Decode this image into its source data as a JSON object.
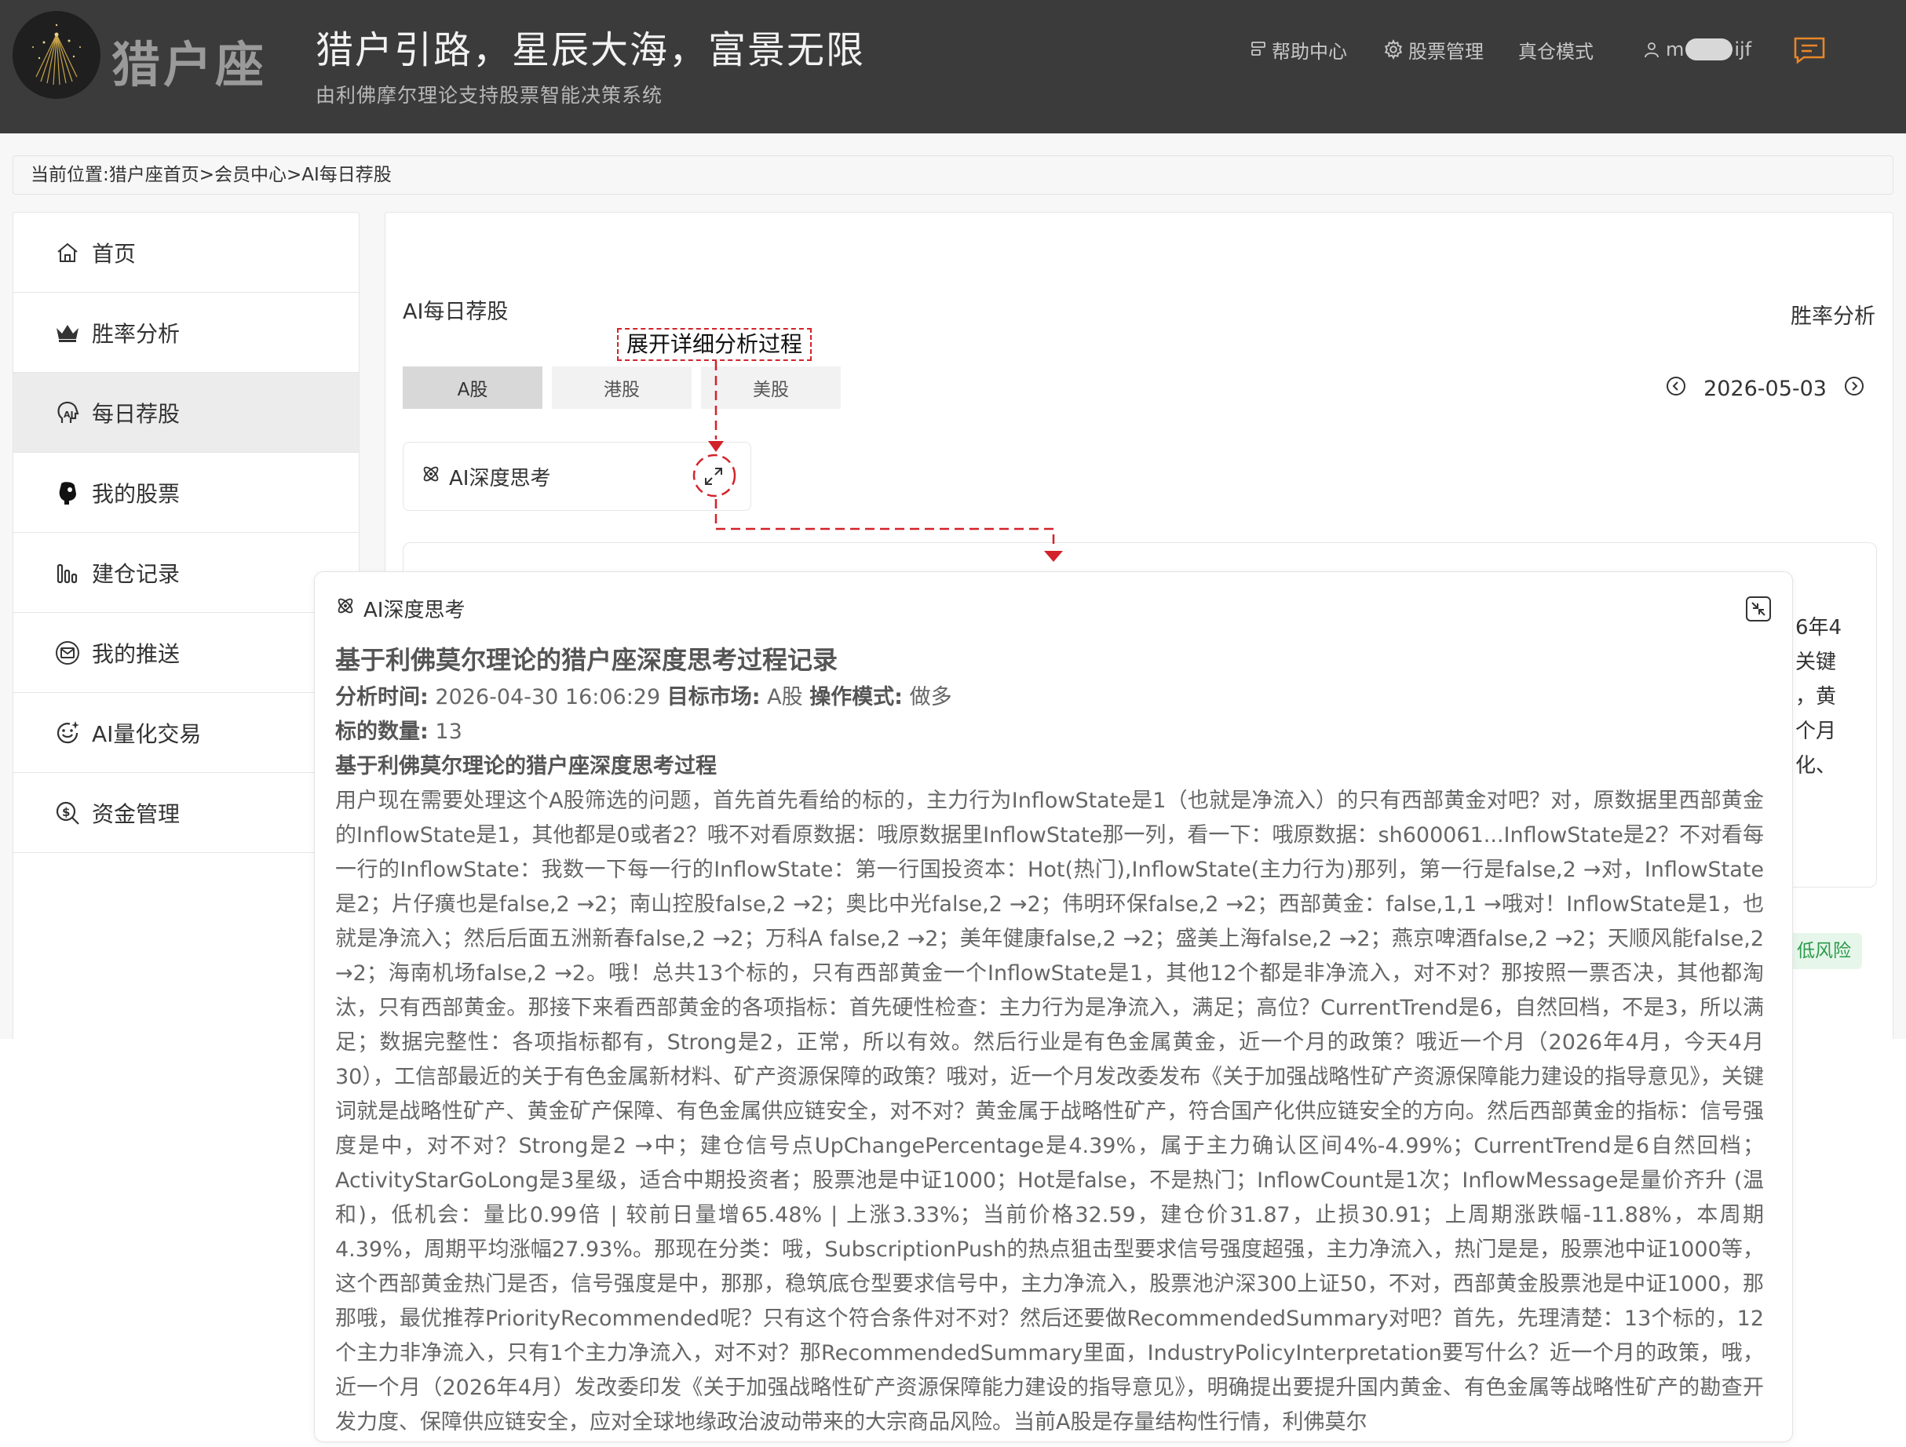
{
  "header": {
    "brand": "猎户座",
    "slogan": "猎户引路，星辰大海，富景无限",
    "subslogan": "由利佛摩尔理论支持股票智能决策系统",
    "nav": {
      "help": "帮助中心",
      "stock_manage": "股票管理",
      "real_mode": "真仓模式",
      "user_prefix": "m",
      "user_suffix": "ijf"
    }
  },
  "breadcrumb": "当前位置:猎户座首页>会员中心>AI每日荐股",
  "sidebar": {
    "items": [
      {
        "label": "首页",
        "icon": "home-icon"
      },
      {
        "label": "胜率分析",
        "icon": "crown-icon"
      },
      {
        "label": "每日荐股",
        "icon": "ai-head-icon"
      },
      {
        "label": "我的股票",
        "icon": "fist-icon"
      },
      {
        "label": "建仓记录",
        "icon": "bar-chart-icon"
      },
      {
        "label": "我的推送",
        "icon": "mail-icon"
      },
      {
        "label": "AI量化交易",
        "icon": "smile-sparkle-icon"
      },
      {
        "label": "资金管理",
        "icon": "money-search-icon"
      }
    ],
    "active_index": 2
  },
  "main": {
    "title": "AI每日荐股",
    "win_rate_link": "胜率分析",
    "tabs": [
      {
        "label": "A股"
      },
      {
        "label": "港股"
      },
      {
        "label": "美股"
      }
    ],
    "date": "2026-05-03",
    "think_card_label": "AI深度思考",
    "peek_lines": [
      "6年4",
      "关键",
      "，黄",
      "个月",
      "化、"
    ],
    "risk_badge": "低风险"
  },
  "annotation": {
    "label": "展开详细分析过程",
    "color": "#d2232a"
  },
  "panel": {
    "title": "AI深度思考",
    "heading": "基于利佛莫尔理论的猎户座深度思考过程记录",
    "meta": {
      "time_label": "分析时间:",
      "time_value": " 2026-04-30 16:06:29 ",
      "market_label": "目标市场:",
      "market_value": " A股 ",
      "mode_label": "操作模式:",
      "mode_value": " 做多",
      "count_label": "标的数量:",
      "count_value": " 13"
    },
    "subheading": "基于利佛莫尔理论的猎户座深度思考过程",
    "body": "用户现在需要处理这个A股筛选的问题，首先首先看给的标的，主力行为InflowState是1（也就是净流入）的只有西部黄金对吧？对，原数据里西部黄金的InflowState是1，其他都是0或者2？哦不对看原数据：哦原数据里InflowState那一列，看一下：哦原数据：sh600061...InflowState是2？不对看每一行的InflowState：我数一下每一行的InflowState：第一行国投资本：Hot(热门),InflowState(主力行为)那列，第一行是false,2 →对，InflowState是2；片仔癀也是false,2 →2；南山控股false,2 →2；奥比中光false,2 →2；伟明环保false,2 →2；西部黄金：false,1,1 →哦对！InflowState是1，也就是净流入；然后后面五洲新春false,2 →2；万科A false,2 →2；美年健康false,2 →2；盛美上海false,2 →2；燕京啤酒false,2 →2；天顺风能false,2 →2；海南机场false,2 →2。哦！总共13个标的，只有西部黄金一个InflowState是1，其他12个都是非净流入，对不对？那按照一票否决，其他都淘汰，只有西部黄金。那接下来看西部黄金的各项指标：首先硬性检查：主力行为是净流入，满足；高位？CurrentTrend是6，自然回档，不是3，所以满足；数据完整性：各项指标都有，Strong是2，正常，所以有效。然后行业是有色金属黄金，近一个月的政策？哦近一个月（2026年4月，今天4月30），工信部最近的关于有色金属新材料、矿产资源保障的政策？哦对，近一个月发改委发布《关于加强战略性矿产资源保障能力建设的指导意见》，关键词就是战略性矿产、黄金矿产保障、有色金属供应链安全，对不对？黄金属于战略性矿产，符合国产化供应链安全的方向。然后西部黄金的指标：信号强度是中，对不对？Strong是2 →中；建仓信号点UpChangePercentage是4.39%，属于主力确认区间4%-4.99%；CurrentTrend是6自然回档；ActivityStarGoLong是3星级，适合中期投资者；股票池是中证1000；Hot是false，不是热门；InflowCount是1次；InflowMessage是量价齐升 (温和)，低机会：量比0.99倍 | 较前日量增65.48% | 上涨3.33%；当前价格32.59，建仓价31.87，止损30.91；上周期涨跌幅-11.88%，本周期4.39%，周期平均涨幅27.93%。那现在分类：哦，SubscriptionPush的热点狙击型要求信号强度超强，主力净流入，热门是是，股票池中证1000等，这个西部黄金热门是否，信号强度是中，那那，稳筑底仓型要求信号中，主力净流入，股票池沪深300上证50，不对，西部黄金股票池是中证1000，那那哦，最优推荐PriorityRecommended呢？只有这个符合条件对不对？然后还要做RecommendedSummary对吧？首先，先理清楚：13个标的，12个主力非净流入，只有1个主力净流入，对不对？那RecommendedSummary里面，IndustryPolicyInterpretation要写什么？近一个月的政策，哦，近一个月（2026年4月）发改委印发《关于加强战略性矿产资源保障能力建设的指导意见》，明确提出要提升国内黄金、有色金属等战略性矿产的勘查开发力度、保障供应链安全，应对全球地缘政治波动带来的大宗商品风险。当前A股是存量结构性行情，利佛莫尔"
  }
}
